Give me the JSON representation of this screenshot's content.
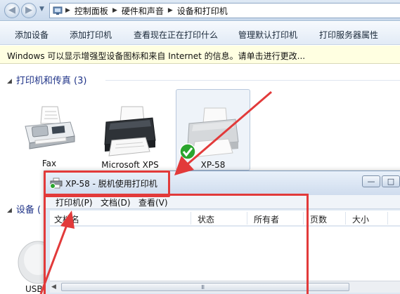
{
  "address_bar": {
    "crumbs": [
      "控制面板",
      "硬件和声音",
      "设备和打印机"
    ]
  },
  "command_bar": {
    "items": [
      "添加设备",
      "添加打印机",
      "查看现在正在打印什么",
      "管理默认打印机",
      "打印服务器属性"
    ]
  },
  "info_bar": {
    "text": "Windows 可以显示增强型设备图标和来自 Internet 的信息。请单击进行更改..."
  },
  "groups": {
    "printers": {
      "header": "打印机和传真 (3)"
    },
    "devices": {
      "header": "设备 ("
    }
  },
  "devices": [
    {
      "label": "Fax",
      "icon": "fax-icon"
    },
    {
      "label": "Microsoft XPS",
      "icon": "printer-icon"
    },
    {
      "label": "XP-58",
      "icon": "printer-icon",
      "default": true,
      "selected": true
    }
  ],
  "partial_device": {
    "label": "USB"
  },
  "queue_window": {
    "title": "XP-58  -  脱机使用打印机",
    "menu": [
      "打印机(P)",
      "文档(D)",
      "查看(V)"
    ],
    "columns": [
      "文档名",
      "状态",
      "所有者",
      "页数",
      "大小"
    ],
    "hscroll_grip": "III"
  },
  "colors": {
    "annotation": "#e23a3a",
    "default_check": "#2aa52e",
    "group_header": "#1e3287"
  }
}
